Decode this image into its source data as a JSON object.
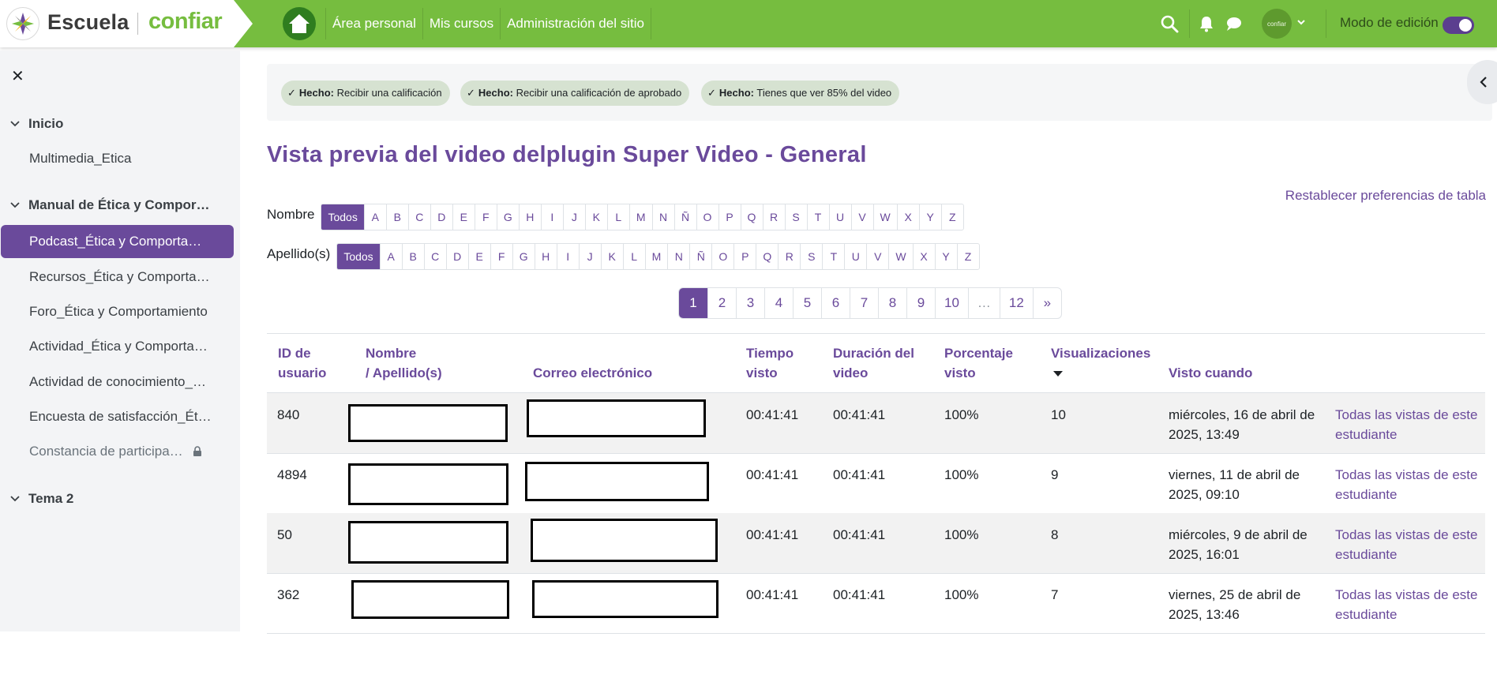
{
  "brand": {
    "school": "Escuela",
    "company": "confiar",
    "avatar_text": "confiar"
  },
  "nav": {
    "links": [
      "Área personal",
      "Mis cursos",
      "Administración del sitio"
    ],
    "edit_mode_label": "Modo de edición",
    "edit_mode_on": true,
    "accent_green": "#76bd3f",
    "accent_purple": "#6a4a9b"
  },
  "drawer": {
    "sections": [
      {
        "title": "Inicio",
        "items": [
          {
            "label": "Multimedia_Etica"
          }
        ]
      },
      {
        "title": "Manual de Ética y Compor…",
        "items": [
          {
            "label": "Podcast_Ética y Comporta…",
            "active": true
          },
          {
            "label": "Recursos_Ética y Comporta…"
          },
          {
            "label": "Foro_Ética y Comportamiento"
          },
          {
            "label": "Actividad_Ética y Comporta…"
          },
          {
            "label": "Actividad de conocimiento_…"
          },
          {
            "label": "Encuesta de satisfacción_Ét…"
          },
          {
            "label": "Constancia de participa…",
            "locked": true
          }
        ]
      },
      {
        "title": "Tema 2",
        "items": []
      }
    ]
  },
  "completion": [
    {
      "done": "Hecho:",
      "text": "Recibir una calificación"
    },
    {
      "done": "Hecho:",
      "text": "Recibir una calificación de aprobado"
    },
    {
      "done": "Hecho:",
      "text": "Tienes que ver 85% del video"
    }
  ],
  "page": {
    "title": "Vista previa del video delplugin Super Video - General",
    "reset_link": "Restablecer preferencias de tabla"
  },
  "filters": {
    "first_name_label": "Nombre",
    "last_name_label": "Apellido(s)",
    "all_label": "Todos",
    "letters": [
      "A",
      "B",
      "C",
      "D",
      "E",
      "F",
      "G",
      "H",
      "I",
      "J",
      "K",
      "L",
      "M",
      "N",
      "Ñ",
      "O",
      "P",
      "Q",
      "R",
      "S",
      "T",
      "U",
      "V",
      "W",
      "X",
      "Y",
      "Z"
    ]
  },
  "pagination": [
    "1",
    "2",
    "3",
    "4",
    "5",
    "6",
    "7",
    "8",
    "9",
    "10",
    "…",
    "12",
    "»"
  ],
  "table": {
    "headers": {
      "user_id": [
        "ID de",
        "usuario"
      ],
      "name": [
        "Nombre",
        "/ Apellido(s)"
      ],
      "email": "Correo electrónico",
      "time": [
        "Tiempo",
        "visto"
      ],
      "duration": [
        "Duración del",
        "video"
      ],
      "percent": [
        "Porcentaje",
        "visto"
      ],
      "views": "Visualizaciones",
      "when": "Visto cuando"
    },
    "rows": [
      {
        "id": "840",
        "time": "00:41:41",
        "duration": "00:41:41",
        "percent": "100%",
        "views": "10",
        "when": [
          "miércoles, 16 de abril de",
          "2025, 13:49"
        ],
        "link": [
          "Todas las vistas de este",
          "estudiante"
        ]
      },
      {
        "id": "4894",
        "time": "00:41:41",
        "duration": "00:41:41",
        "percent": "100%",
        "views": "9",
        "when": [
          "viernes, 11 de abril de",
          "2025, 09:10"
        ],
        "link": [
          "Todas las vistas de este",
          "estudiante"
        ]
      },
      {
        "id": "50",
        "time": "00:41:41",
        "duration": "00:41:41",
        "percent": "100%",
        "views": "8",
        "when": [
          "miércoles, 9 de abril de",
          "2025, 16:01"
        ],
        "link": [
          "Todas las vistas de este",
          "estudiante"
        ]
      },
      {
        "id": "362",
        "time": "00:41:41",
        "duration": "00:41:41",
        "percent": "100%",
        "views": "7",
        "when": [
          "viernes, 25 de abril de",
          "2025, 13:46"
        ],
        "link": [
          "Todas las vistas de este",
          "estudiante"
        ]
      }
    ]
  }
}
